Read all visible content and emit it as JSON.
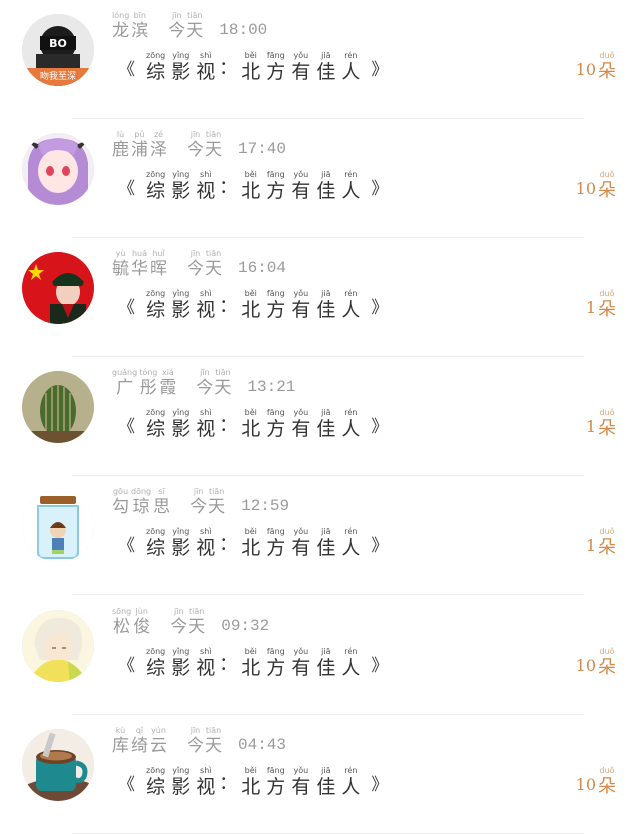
{
  "entries": [
    {
      "name": [
        {
          "py": "lóng",
          "hz": "龙"
        },
        {
          "py": "bīn",
          "hz": "滨"
        }
      ],
      "when": [
        {
          "py": "jīn",
          "hz": "今"
        },
        {
          "py": "tiān",
          "hz": "天"
        }
      ],
      "time": "18:00",
      "count": "10",
      "unit": {
        "py": "duǒ",
        "hz": "朵"
      }
    },
    {
      "name": [
        {
          "py": "lù",
          "hz": "鹿"
        },
        {
          "py": "pǔ",
          "hz": "浦"
        },
        {
          "py": "zé",
          "hz": "泽"
        }
      ],
      "when": [
        {
          "py": "jīn",
          "hz": "今"
        },
        {
          "py": "tiān",
          "hz": "天"
        }
      ],
      "time": "17:40",
      "count": "10",
      "unit": {
        "py": "duǒ",
        "hz": "朵"
      }
    },
    {
      "name": [
        {
          "py": "yù",
          "hz": "毓"
        },
        {
          "py": "huá",
          "hz": "华"
        },
        {
          "py": "huǐ",
          "hz": "晖"
        }
      ],
      "when": [
        {
          "py": "jīn",
          "hz": "今"
        },
        {
          "py": "tiān",
          "hz": "天"
        }
      ],
      "time": "16:04",
      "count": "1",
      "unit": {
        "py": "duǒ",
        "hz": "朵"
      }
    },
    {
      "name": [
        {
          "py": "guǎng",
          "hz": "广"
        },
        {
          "py": "tóng",
          "hz": "彤"
        },
        {
          "py": "xiá",
          "hz": "霞"
        }
      ],
      "when": [
        {
          "py": "jīn",
          "hz": "今"
        },
        {
          "py": "tiān",
          "hz": "天"
        }
      ],
      "time": "13:21",
      "count": "1",
      "unit": {
        "py": "duǒ",
        "hz": "朵"
      }
    },
    {
      "name": [
        {
          "py": "gōu",
          "hz": "勾"
        },
        {
          "py": "dōng",
          "hz": "琼"
        },
        {
          "py": "sī",
          "hz": "思"
        }
      ],
      "when": [
        {
          "py": "jīn",
          "hz": "今"
        },
        {
          "py": "tiān",
          "hz": "天"
        }
      ],
      "time": "12:59",
      "count": "1",
      "unit": {
        "py": "duǒ",
        "hz": "朵"
      }
    },
    {
      "name": [
        {
          "py": "sōng",
          "hz": "松"
        },
        {
          "py": "jùn",
          "hz": "俊"
        }
      ],
      "when": [
        {
          "py": "jīn",
          "hz": "今"
        },
        {
          "py": "tiān",
          "hz": "天"
        }
      ],
      "time": "09:32",
      "count": "10",
      "unit": {
        "py": "duǒ",
        "hz": "朵"
      }
    },
    {
      "name": [
        {
          "py": "kù",
          "hz": "库"
        },
        {
          "py": "qǐ",
          "hz": "绮"
        },
        {
          "py": "yún",
          "hz": "云"
        }
      ],
      "when": [
        {
          "py": "jīn",
          "hz": "今"
        },
        {
          "py": "tiān",
          "hz": "天"
        }
      ],
      "time": "04:43",
      "count": "10",
      "unit": {
        "py": "duǒ",
        "hz": "朵"
      }
    }
  ],
  "item_title": {
    "left_bracket": "《",
    "right_bracket": "》",
    "chars": [
      {
        "py": "zōng",
        "hz": "综"
      },
      {
        "py": "yǐng",
        "hz": "影"
      },
      {
        "py": "shì",
        "hz": "视"
      }
    ],
    "colon": "：",
    "chars2": [
      {
        "py": "běi",
        "hz": "北"
      },
      {
        "py": "fāng",
        "hz": "方"
      },
      {
        "py": "yǒu",
        "hz": "有"
      },
      {
        "py": "jiā",
        "hz": "佳"
      },
      {
        "py": "rén",
        "hz": "人"
      }
    ]
  },
  "avatar_badge_text": "吻我至深",
  "colors": {
    "count": "#d4894a",
    "pinyin": "#b0b0b0",
    "divider": "#ececec"
  }
}
